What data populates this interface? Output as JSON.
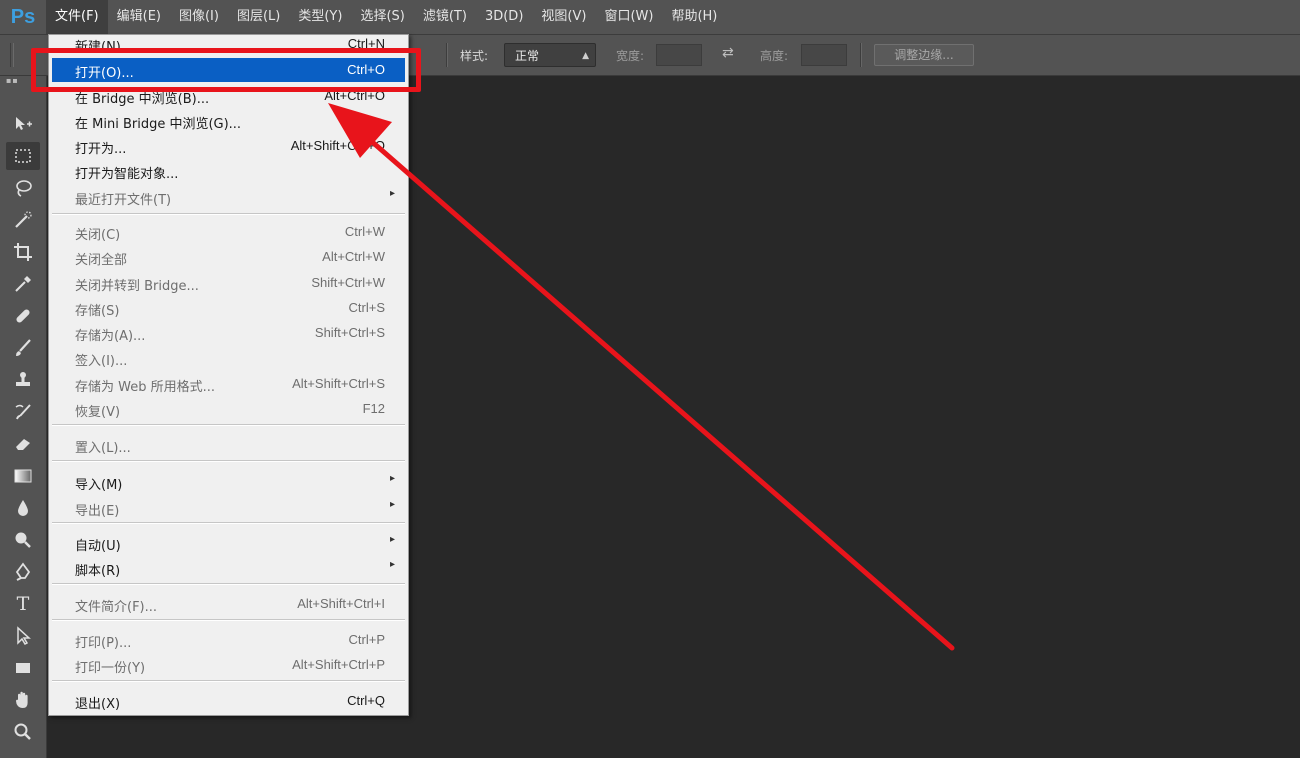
{
  "app": {
    "logo": "Ps"
  },
  "menubar": {
    "items": [
      {
        "label": "文件(F)"
      },
      {
        "label": "编辑(E)"
      },
      {
        "label": "图像(I)"
      },
      {
        "label": "图层(L)"
      },
      {
        "label": "类型(Y)"
      },
      {
        "label": "选择(S)"
      },
      {
        "label": "滤镜(T)"
      },
      {
        "label": "3D(D)"
      },
      {
        "label": "视图(V)"
      },
      {
        "label": "窗口(W)"
      },
      {
        "label": "帮助(H)"
      }
    ]
  },
  "options_bar": {
    "style_label": "样式:",
    "style_value": "正常",
    "width_label": "宽度:",
    "height_label": "高度:",
    "refine_button": "调整边缘..."
  },
  "toolbar": {
    "header": "▪▪",
    "tools": [
      {
        "name": "move-tool",
        "icon": "move-icon"
      },
      {
        "name": "marquee-tool",
        "icon": "rect-marquee-icon"
      },
      {
        "name": "lasso-tool",
        "icon": "lasso-icon"
      },
      {
        "name": "quick-select-tool",
        "icon": "quick-select-icon"
      },
      {
        "name": "crop-tool",
        "icon": "crop-icon"
      },
      {
        "name": "eyedropper-tool",
        "icon": "eyedropper-icon"
      },
      {
        "name": "healing-tool",
        "icon": "bandage-icon"
      },
      {
        "name": "brush-tool",
        "icon": "brush-icon"
      },
      {
        "name": "stamp-tool",
        "icon": "stamp-icon"
      },
      {
        "name": "history-brush-tool",
        "icon": "history-brush-icon"
      },
      {
        "name": "eraser-tool",
        "icon": "eraser-icon"
      },
      {
        "name": "gradient-tool",
        "icon": "gradient-icon"
      },
      {
        "name": "blur-tool",
        "icon": "drop-icon"
      },
      {
        "name": "dodge-tool",
        "icon": "dodge-icon"
      },
      {
        "name": "pen-tool",
        "icon": "pen-icon"
      },
      {
        "name": "type-tool",
        "icon": "type-icon"
      },
      {
        "name": "path-select-tool",
        "icon": "arrow-select-icon"
      },
      {
        "name": "shape-tool",
        "icon": "rectangle-icon"
      },
      {
        "name": "hand-tool",
        "icon": "hand-icon"
      },
      {
        "name": "zoom-tool",
        "icon": "zoom-icon"
      }
    ],
    "type_glyph": "T"
  },
  "file_menu": {
    "items": [
      {
        "label": "新建(N)...",
        "shortcut": "Ctrl+N"
      },
      {
        "label": "打开(O)...",
        "shortcut": "Ctrl+O"
      },
      {
        "label": "在 Bridge 中浏览(B)...",
        "shortcut": "Alt+Ctrl+O"
      },
      {
        "label": "在 Mini Bridge 中浏览(G)...",
        "shortcut": ""
      },
      {
        "label": "打开为...",
        "shortcut": "Alt+Shift+Ctrl+O"
      },
      {
        "label": "打开为智能对象...",
        "shortcut": ""
      },
      {
        "label": "最近打开文件(T)",
        "shortcut": "",
        "submenu": "▸"
      },
      {
        "label": "关闭(C)",
        "shortcut": "Ctrl+W"
      },
      {
        "label": "关闭全部",
        "shortcut": "Alt+Ctrl+W"
      },
      {
        "label": "关闭并转到 Bridge...",
        "shortcut": "Shift+Ctrl+W"
      },
      {
        "label": "存储(S)",
        "shortcut": "Ctrl+S"
      },
      {
        "label": "存储为(A)...",
        "shortcut": "Shift+Ctrl+S"
      },
      {
        "label": "签入(I)...",
        "shortcut": ""
      },
      {
        "label": "存储为 Web 所用格式...",
        "shortcut": "Alt+Shift+Ctrl+S"
      },
      {
        "label": "恢复(V)",
        "shortcut": "F12"
      },
      {
        "label": "置入(L)...",
        "shortcut": ""
      },
      {
        "label": "导入(M)",
        "shortcut": "",
        "submenu": "▸"
      },
      {
        "label": "导出(E)",
        "shortcut": "",
        "submenu": "▸"
      },
      {
        "label": "自动(U)",
        "shortcut": "",
        "submenu": "▸"
      },
      {
        "label": "脚本(R)",
        "shortcut": "",
        "submenu": "▸"
      },
      {
        "label": "文件简介(F)...",
        "shortcut": "Alt+Shift+Ctrl+I"
      },
      {
        "label": "打印(P)...",
        "shortcut": "Ctrl+P"
      },
      {
        "label": "打印一份(Y)",
        "shortcut": "Alt+Shift+Ctrl+P"
      },
      {
        "label": "退出(X)",
        "shortcut": "Ctrl+Q"
      }
    ]
  },
  "colors": {
    "highlight": "#0a5fc4",
    "annotation": "#e8141b",
    "canvas": "#282828",
    "chrome": "#535353"
  }
}
